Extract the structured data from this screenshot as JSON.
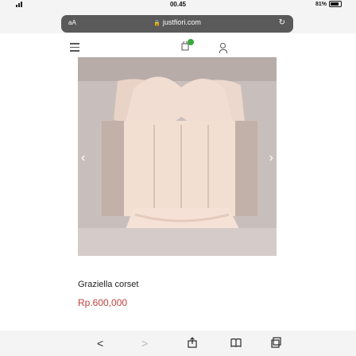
{
  "status_bar": {
    "time": "00.45",
    "left": "",
    "battery": "81%"
  },
  "address_bar": {
    "aa": "aA",
    "url": "justfiori.com"
  },
  "header": {
    "menu_icon": "hamburger-menu-icon",
    "bag_icon": "shopping-bag-icon",
    "user_icon": "user-icon"
  },
  "product": {
    "name": "Graziella corset",
    "price": "Rp.600,000"
  },
  "toolbar": {
    "back": "<",
    "forward": ">"
  }
}
